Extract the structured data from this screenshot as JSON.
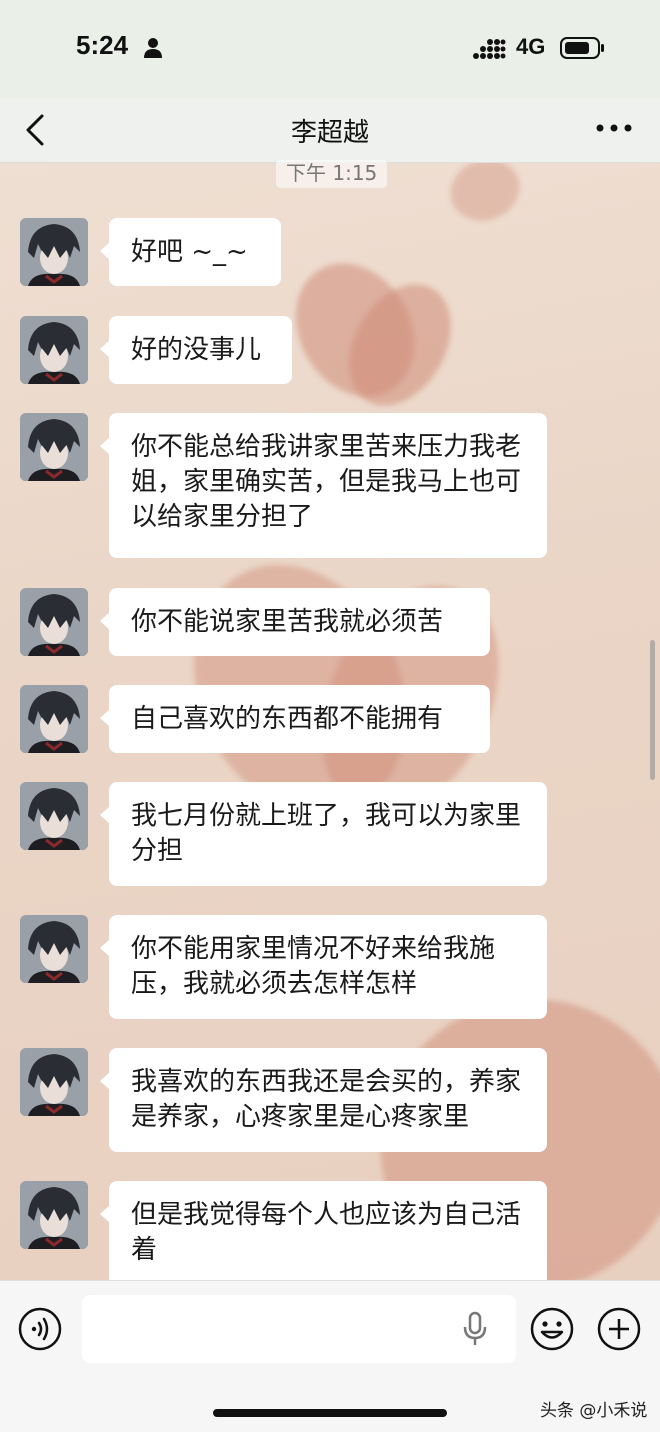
{
  "status_bar": {
    "time": "5:24",
    "network": "4G",
    "icons": [
      "person-icon",
      "signal-icon",
      "battery-icon"
    ]
  },
  "nav": {
    "title": "李超越",
    "icons": [
      "back-icon",
      "more-icon"
    ]
  },
  "timestamp": "下午 1:15",
  "messages": [
    {
      "text": "好吧 ~_~"
    },
    {
      "text": "好的没事儿"
    },
    {
      "text": "你不能总给我讲家里苦来压力我老姐，家里确实苦，但是我马上也可以给家里分担了"
    },
    {
      "text": "你不能说家里苦我就必须苦"
    },
    {
      "text": "自己喜欢的东西都不能拥有"
    },
    {
      "text": "我七月份就上班了，我可以为家里分担"
    },
    {
      "text": "你不能用家里情况不好来给我施压，我就必须去怎样怎样"
    },
    {
      "text": "我喜欢的东西我还是会买的，养家是养家，心疼家里是心疼家里"
    },
    {
      "text": "但是我觉得每个人也应该为自己活着"
    }
  ],
  "input_bar": {
    "text_value": "",
    "icons": [
      "voice-icon",
      "mic-icon",
      "emoji-icon",
      "plus-icon"
    ]
  },
  "watermark": "头条 @小禾说",
  "colors": {
    "bubble": "#ffffff",
    "chat_background": "#ecd9cc",
    "status_bar": "#eaf0e8"
  }
}
